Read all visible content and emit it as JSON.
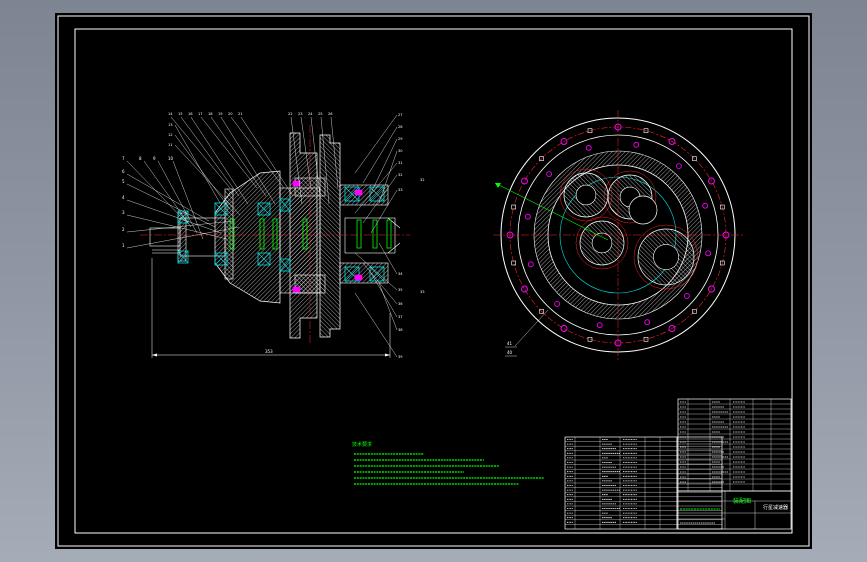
{
  "colors": {
    "background": "#000000",
    "frame": "#ffffff",
    "hatch": "#e0e0e0",
    "cyan": "#00e0e0",
    "green": "#00ff00",
    "red": "#ff2020",
    "magenta": "#ff00ff",
    "yellow": "#ffff00"
  },
  "left_view": {
    "balloons_left": [
      "7",
      "8",
      "9",
      "10",
      "6",
      "5",
      "4",
      "3",
      "2",
      "1"
    ],
    "balloons_top": [
      "14",
      "15",
      "16",
      "17",
      "18",
      "19",
      "20",
      "21",
      "22",
      "23",
      "24",
      "25",
      "26"
    ],
    "balloons_stack": [
      "13",
      "12",
      "11"
    ],
    "balloons_right": [
      "27",
      "28",
      "29",
      "30",
      "31",
      "32",
      "33",
      "34",
      "35",
      "36",
      "37",
      "38",
      "39"
    ],
    "dimension_text": "353"
  },
  "right_view": {
    "balloons": [
      "41",
      "40"
    ]
  },
  "technical_requirements": {
    "title": "技术要求"
  },
  "title_block": {
    "title": "装配图",
    "subtitle": "行星减速器"
  }
}
